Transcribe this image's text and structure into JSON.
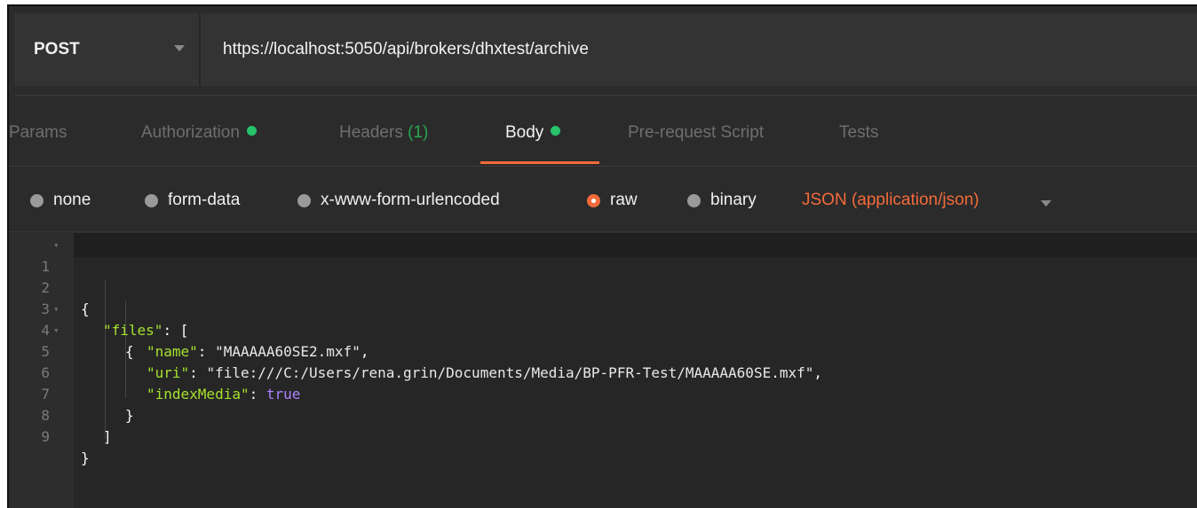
{
  "request": {
    "method": "POST",
    "url": "https://localhost:5050/api/brokers/dhxtest/archive"
  },
  "tabs": {
    "params": "Params",
    "authorization": "Authorization",
    "headers": "Headers",
    "headers_count": "(1)",
    "body": "Body",
    "prerequest": "Pre-request Script",
    "tests": "Tests"
  },
  "body_types": {
    "none": "none",
    "form_data": "form-data",
    "urlencoded": "x-www-form-urlencoded",
    "raw": "raw",
    "binary": "binary",
    "selected": "raw",
    "content_type": "JSON (application/json)"
  },
  "editor": {
    "line_numbers": [
      "1",
      "2",
      "3",
      "4",
      "5",
      "6",
      "7",
      "8",
      "9"
    ],
    "lines": {
      "l1": "{",
      "l2_key": "\"files\"",
      "l2_rest": ": [",
      "l3": "{",
      "l4_key": "\"name\"",
      "l4_sep": ": ",
      "l4_val": "\"MAAAAA60SE2.mxf\"",
      "l4_end": ",",
      "l5_key": "\"uri\"",
      "l5_sep": ": ",
      "l5_val": "\"file:///C:/Users/rena.grin/Documents/Media/BP-PFR-Test/MAAAAA60SE.mxf\"",
      "l5_end": ",",
      "l6_key": "\"indexMedia\"",
      "l6_sep": ": ",
      "l6_val": "true",
      "l7": "}",
      "l8": "]",
      "l9": "}"
    }
  },
  "colors": {
    "accent": "#f26b3a",
    "status_dot": "#27c36a",
    "json_key": "#a6e22e",
    "json_bool": "#ae81ff"
  }
}
